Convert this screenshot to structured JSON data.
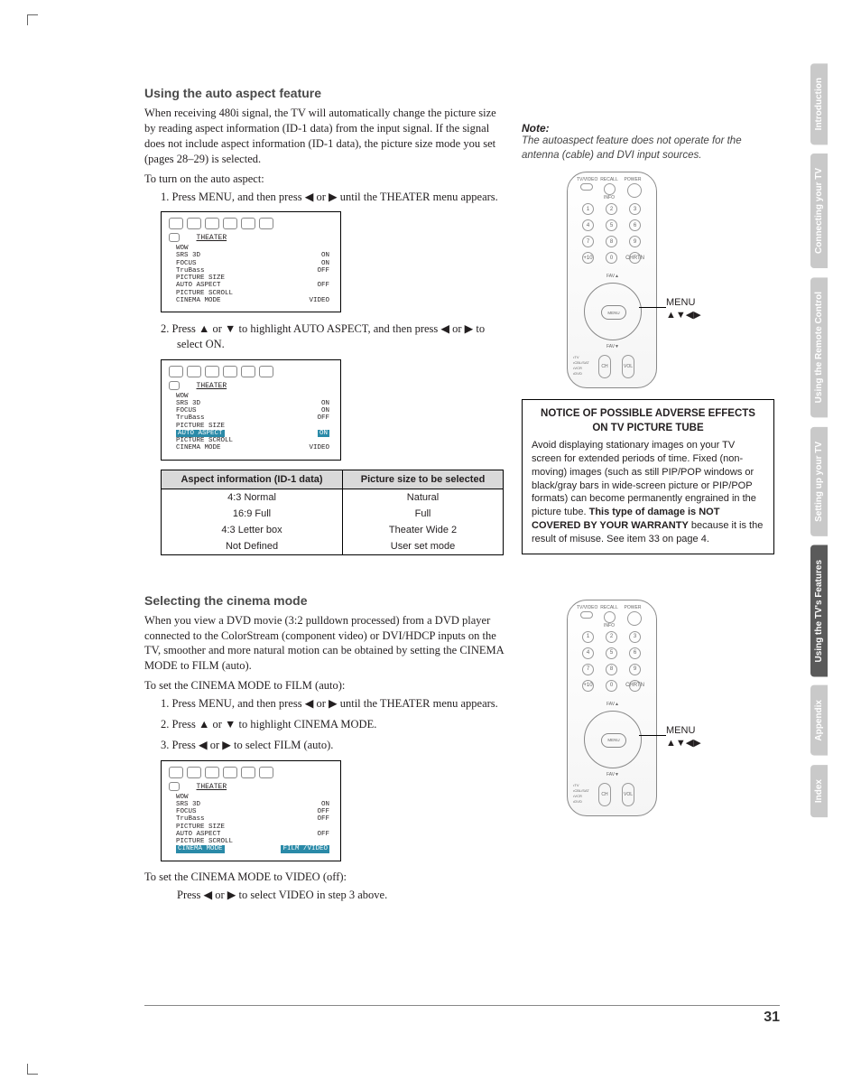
{
  "section1": {
    "heading": "Using the auto aspect feature",
    "para1": "When receiving 480i signal, the TV will automatically change the picture size by reading aspect information (ID-1 data) from the input signal. If the signal does not include aspect information (ID-1 data), the picture size mode you set (pages 28–29) is selected.",
    "intro": "To turn on the auto aspect:",
    "step1": "1.  Press MENU, and then press ◀ or ▶ until the THEATER menu appears.",
    "step2": "2.  Press ▲ or ▼ to highlight AUTO ASPECT, and then press ◀ or ▶ to select ON."
  },
  "osd": {
    "title": "THEATER",
    "rows": [
      {
        "l": "WOW",
        "r": ""
      },
      {
        "l": "  SRS 3D",
        "r": "ON"
      },
      {
        "l": "  FOCUS",
        "r": "ON"
      },
      {
        "l": "  TruBass",
        "r": "OFF"
      },
      {
        "l": "PICTURE SIZE",
        "r": ""
      },
      {
        "l": "AUTO ASPECT",
        "r": "OFF"
      },
      {
        "l": "PICTURE SCROLL",
        "r": ""
      },
      {
        "l": "CINEMA MODE",
        "r": "VIDEO"
      }
    ],
    "rows2": [
      {
        "l": "WOW",
        "r": ""
      },
      {
        "l": "  SRS 3D",
        "r": "ON"
      },
      {
        "l": "  FOCUS",
        "r": "ON"
      },
      {
        "l": "  TruBass",
        "r": "OFF"
      },
      {
        "l": "PICTURE SIZE",
        "r": ""
      },
      {
        "l": "AUTO ASPECT",
        "r": "ON",
        "hi": true
      },
      {
        "l": "PICTURE SCROLL",
        "r": ""
      },
      {
        "l": "CINEMA MODE",
        "r": "VIDEO"
      }
    ],
    "rows3": [
      {
        "l": "WOW",
        "r": ""
      },
      {
        "l": "  SRS 3D",
        "r": "ON"
      },
      {
        "l": "  FOCUS",
        "r": "OFF"
      },
      {
        "l": "  TruBass",
        "r": "OFF"
      },
      {
        "l": "PICTURE SIZE",
        "r": ""
      },
      {
        "l": "AUTO ASPECT",
        "r": "OFF"
      },
      {
        "l": "PICTURE SCROLL",
        "r": ""
      },
      {
        "l": "CINEMA MODE",
        "r": "FILM /VIDEO",
        "hi": true
      }
    ]
  },
  "table": {
    "h1": "Aspect information (ID-1 data)",
    "h2": "Picture size to be selected",
    "rows": [
      [
        "4:3 Normal",
        "Natural"
      ],
      [
        "16:9 Full",
        "Full"
      ],
      [
        "4:3 Letter box",
        "Theater Wide 2"
      ],
      [
        "Not Defined",
        "User set mode"
      ]
    ]
  },
  "section2": {
    "heading": "Selecting the cinema mode",
    "para1": "When you view a DVD movie (3:2 pulldown processed) from a DVD player connected to the ColorStream (component video) or DVI/HDCP inputs on the TV, smoother and more natural motion can be obtained by setting the CINEMA MODE to FILM (auto).",
    "intro": "To set the CINEMA MODE to FILM (auto):",
    "step1": "1.  Press MENU, and then press ◀ or ▶ until the THEATER menu appears.",
    "step2": "2.  Press ▲ or ▼ to highlight CINEMA MODE.",
    "step3": "3.  Press ◀ or ▶ to select FILM (auto).",
    "out1": "To set the CINEMA MODE to VIDEO (off):",
    "out2": "Press ◀ or ▶ to select VIDEO in step 3 above."
  },
  "note": {
    "label": "Note:",
    "text": "The autoaspect feature does not operate for the antenna (cable) and DVI input sources."
  },
  "notice": {
    "title": "NOTICE OF POSSIBLE ADVERSE EFFECTS ON TV PICTURE TUBE",
    "b1": "Avoid displaying stationary images on your TV screen for extended periods of time. Fixed (non-moving) images (such as still PIP/POP windows or black/gray bars in wide-screen picture or PIP/POP formats) can become permanently engrained in the picture tube. ",
    "bold": "This type of damage is NOT COVERED BY YOUR WARRANTY",
    "b2": " because it is the result of misuse. See item 33 on page 4."
  },
  "remote": {
    "menu": "MENU",
    "arrows": "▲▼◀▶",
    "top": [
      "TV/VIDEO",
      "RECALL",
      "POWER"
    ],
    "info": "INFO",
    "nums": [
      "1",
      "2",
      "3",
      "4",
      "5",
      "6",
      "7",
      "8",
      "9",
      "+10",
      "0",
      "CHRTN"
    ],
    "fav_up": "FAV▲",
    "fav_dn": "FAV▼",
    "center": "MENU DVDMENU",
    "mode": [
      "TV",
      "CBL/SAT",
      "VCR",
      "DVD"
    ],
    "ch": "CH",
    "vol": "VOL"
  },
  "tabs": [
    "Introduction",
    "Connecting your TV",
    "Using the Remote Control",
    "Setting up your TV",
    "Using the TV's Features",
    "Appendix",
    "Index"
  ],
  "active_tab": 4,
  "pagenum": "31"
}
